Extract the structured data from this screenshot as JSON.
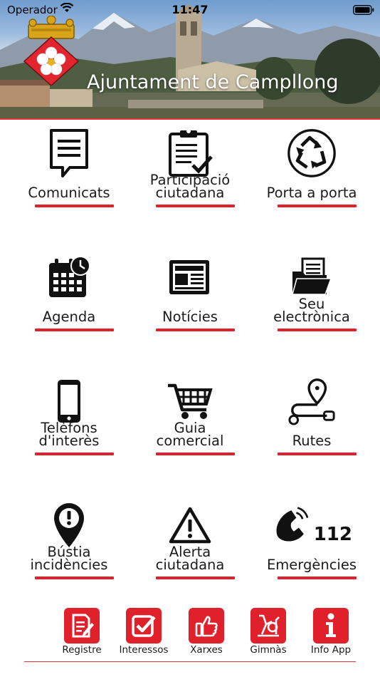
{
  "status_bar": {
    "carrier": "Operador",
    "time": "11:47"
  },
  "header": {
    "title": "Ajuntament de Campllong"
  },
  "grid": [
    {
      "label_lines": [
        "Comunicats"
      ],
      "icon": "chat-document-icon"
    },
    {
      "label_lines": [
        "Participació",
        "ciutadana"
      ],
      "icon": "clipboard-check-icon"
    },
    {
      "label_lines": [
        "Porta a porta"
      ],
      "icon": "recycle-icon"
    },
    {
      "label_lines": [
        "Agenda"
      ],
      "icon": "calendar-clock-icon"
    },
    {
      "label_lines": [
        "Notícies"
      ],
      "icon": "newspaper-icon"
    },
    {
      "label_lines": [
        "Seu",
        "electrònica"
      ],
      "icon": "folder-document-icon"
    },
    {
      "label_lines": [
        "Telèfons",
        "d'interès"
      ],
      "icon": "smartphone-icon"
    },
    {
      "label_lines": [
        "Guia",
        "comercial"
      ],
      "icon": "shopping-cart-icon"
    },
    {
      "label_lines": [
        "Rutes"
      ],
      "icon": "route-pin-icon"
    },
    {
      "label_lines": [
        "Bústia",
        "incidències"
      ],
      "icon": "alert-pin-icon"
    },
    {
      "label_lines": [
        "Alerta",
        "ciutadana"
      ],
      "icon": "warning-triangle-icon"
    },
    {
      "label_lines": [
        "Emergències"
      ],
      "icon": "phone-112-icon"
    }
  ],
  "emergency_number": "112",
  "bottom_bar": [
    {
      "label": "Registre",
      "icon": "register-document-icon"
    },
    {
      "label": "Interessos",
      "icon": "checkbox-icon"
    },
    {
      "label": "Xarxes",
      "icon": "thumbs-up-icon"
    },
    {
      "label": "Gimnàs",
      "icon": "exercise-bike-icon"
    },
    {
      "label": "Info App",
      "icon": "info-icon"
    }
  ],
  "colors": {
    "accent": "#e0212b",
    "text": "#1b1b1b",
    "icon": "#111111",
    "background": "#ffffff"
  }
}
